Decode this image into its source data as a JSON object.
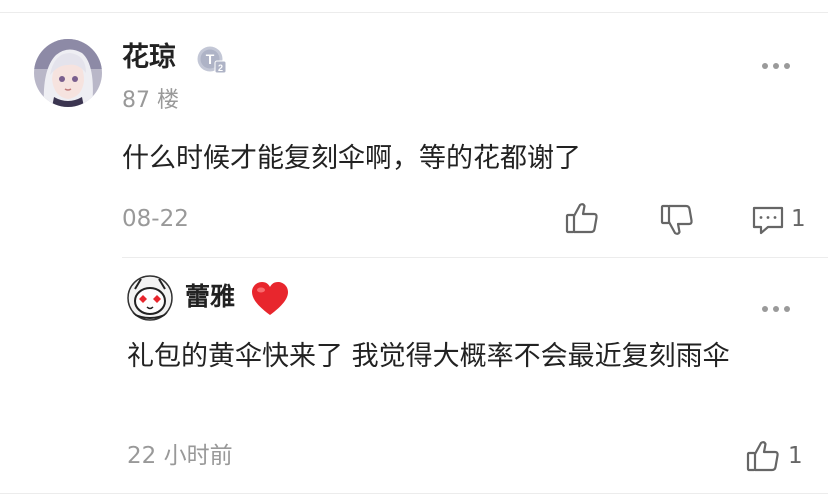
{
  "comment": {
    "avatar_icon": "anime-avatar",
    "username": "花琼",
    "level_badge": "T",
    "level_sub": "2",
    "floor": "87 楼",
    "text": "什么时候才能复刻伞啊，等的花都谢了",
    "date": "08-22",
    "actions": {
      "like_icon": "thumbs-up-icon",
      "dislike_icon": "thumbs-down-icon",
      "reply_icon": "comment-icon",
      "reply_count": "1"
    }
  },
  "reply": {
    "avatar_icon": "cartoon-avatar",
    "username": "蕾雅",
    "badge_icon": "heart-icon",
    "text": "礼包的黄伞快来了  我觉得大概率不会最近复刻雨伞",
    "time": "22 小时前",
    "like_count": "1"
  },
  "colors": {
    "muted_text": "#999999",
    "primary_text": "#222222",
    "heart": "#e8262d",
    "divider": "#ececec"
  }
}
